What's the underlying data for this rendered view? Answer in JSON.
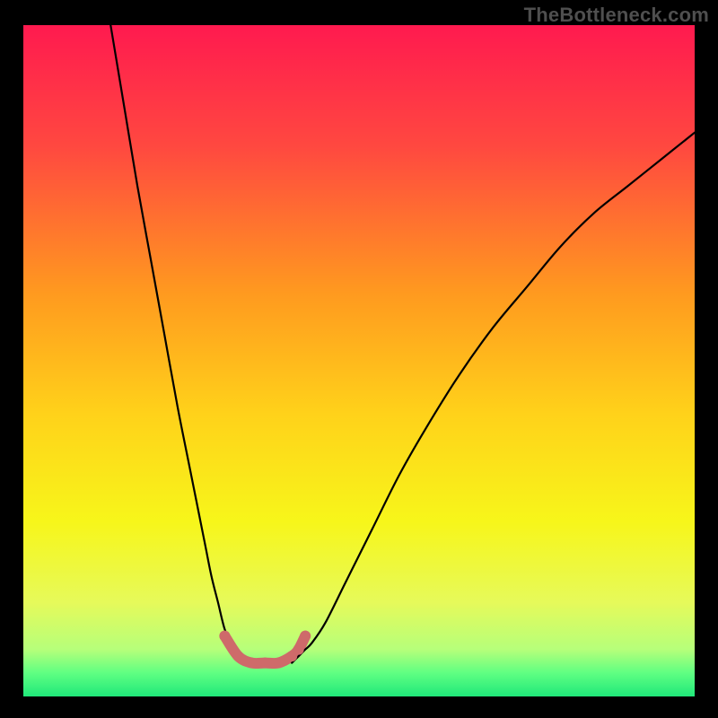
{
  "watermark": "TheBottleneck.com",
  "chart_data": {
    "type": "line",
    "title": "",
    "xlabel": "",
    "ylabel": "",
    "xlim": [
      0,
      100
    ],
    "ylim": [
      0,
      100
    ],
    "grid": false,
    "legend": false,
    "series": [
      {
        "name": "curve-left",
        "x": [
          13,
          15,
          17,
          19,
          21,
          23,
          25,
          27,
          28,
          29,
          30,
          31,
          32,
          33,
          34
        ],
        "y": [
          100,
          88,
          76,
          65,
          54,
          43,
          33,
          23,
          18,
          14,
          10,
          8,
          6,
          5,
          5
        ],
        "stroke": "#000000",
        "width": 2.2
      },
      {
        "name": "curve-right",
        "x": [
          40,
          41,
          42,
          43,
          45,
          48,
          52,
          56,
          60,
          65,
          70,
          75,
          80,
          85,
          90,
          95,
          100
        ],
        "y": [
          5,
          6,
          7,
          8,
          11,
          17,
          25,
          33,
          40,
          48,
          55,
          61,
          67,
          72,
          76,
          80,
          84
        ],
        "stroke": "#000000",
        "width": 2.2
      },
      {
        "name": "optimal-band-dots",
        "x": [
          30,
          32,
          34,
          36,
          38,
          40,
          41,
          42
        ],
        "y": [
          9,
          6,
          5,
          5,
          5,
          6,
          7,
          9
        ],
        "stroke": "#ce6a6a",
        "width": 12,
        "style": "dots"
      }
    ],
    "background_gradient": {
      "stops": [
        {
          "offset": 0.0,
          "color": "#ff1a4f"
        },
        {
          "offset": 0.18,
          "color": "#ff4840"
        },
        {
          "offset": 0.4,
          "color": "#ff9a1f"
        },
        {
          "offset": 0.58,
          "color": "#ffd21a"
        },
        {
          "offset": 0.74,
          "color": "#f7f61a"
        },
        {
          "offset": 0.86,
          "color": "#e6fa5a"
        },
        {
          "offset": 0.93,
          "color": "#b6ff7a"
        },
        {
          "offset": 0.965,
          "color": "#5fff82"
        },
        {
          "offset": 1.0,
          "color": "#20e87a"
        }
      ]
    }
  }
}
